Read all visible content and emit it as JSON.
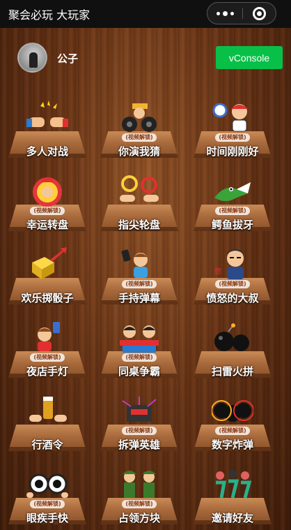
{
  "header": {
    "title": "聚会必玩 大玩家"
  },
  "profile": {
    "username": "公子"
  },
  "debug": {
    "vconsole_label": "vConsole"
  },
  "unlock_badge": "(视频解锁)",
  "games": [
    {
      "label": "多人对战",
      "icon": "fist-bump-icon",
      "locked": false
    },
    {
      "label": "你演我猜",
      "icon": "film-reel-icon",
      "locked": true
    },
    {
      "label": "时间刚刚好",
      "icon": "alarm-clock-icon",
      "locked": true
    },
    {
      "label": "幸运转盘",
      "icon": "lucky-wheel-icon",
      "locked": true
    },
    {
      "label": "指尖轮盘",
      "icon": "fingertip-spinner-icon",
      "locked": false
    },
    {
      "label": "鳄鱼拔牙",
      "icon": "crocodile-icon",
      "locked": true
    },
    {
      "label": "欢乐掷骰子",
      "icon": "dice-icon",
      "locked": false
    },
    {
      "label": "手持弹幕",
      "icon": "phone-danmaku-icon",
      "locked": true
    },
    {
      "label": "愤怒的大叔",
      "icon": "angry-uncle-icon",
      "locked": true
    },
    {
      "label": "夜店手灯",
      "icon": "club-phone-light-icon",
      "locked": true
    },
    {
      "label": "同桌争霸",
      "icon": "desk-duel-icon",
      "locked": true
    },
    {
      "label": "扫雷火拼",
      "icon": "bomb-icon",
      "locked": false
    },
    {
      "label": "行酒令",
      "icon": "beer-cheers-icon",
      "locked": false
    },
    {
      "label": "拆弹英雄",
      "icon": "defuse-bomb-icon",
      "locked": true
    },
    {
      "label": "数字炸弹",
      "icon": "number-bomb-icon",
      "locked": true
    },
    {
      "label": "眼疾手快",
      "icon": "eyes-icon",
      "locked": true
    },
    {
      "label": "占领方块",
      "icon": "soldiers-icon",
      "locked": true
    },
    {
      "label": "邀请好友",
      "icon": "invite-dancers-icon",
      "locked": false
    }
  ]
}
